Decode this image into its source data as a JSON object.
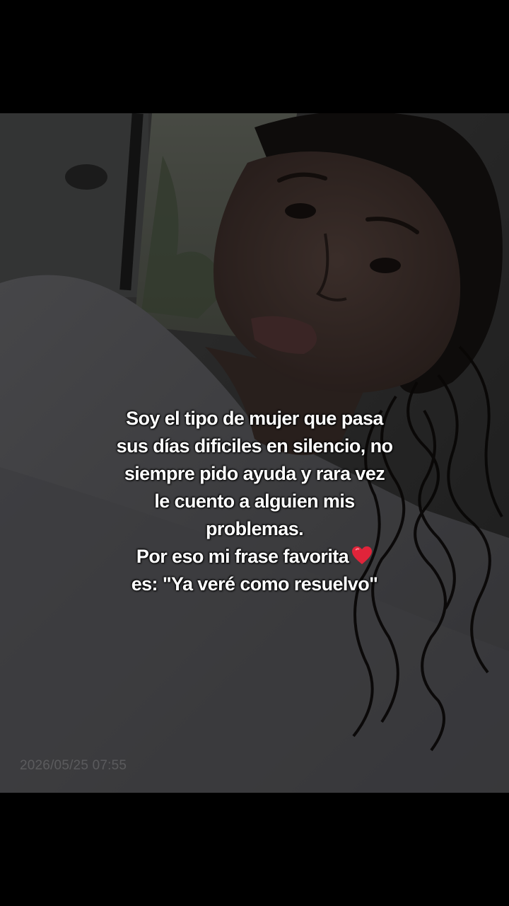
{
  "post": {
    "caption_lines": [
      "Soy el tipo de mujer que pasa",
      "sus días dificiles en silencio, no",
      "siempre pido ayuda y rara vez",
      "le cuento a alguien mis",
      "problemas.",
      "Por eso mi frase favorita",
      "es: \"Ya veré como resuelvo\""
    ],
    "emoji": "heart-icon",
    "timestamp": "2026/05/25 07:55"
  },
  "colors": {
    "letterbox": "#000000",
    "caption_text": "#ffffff",
    "heart": "#e0243a"
  }
}
